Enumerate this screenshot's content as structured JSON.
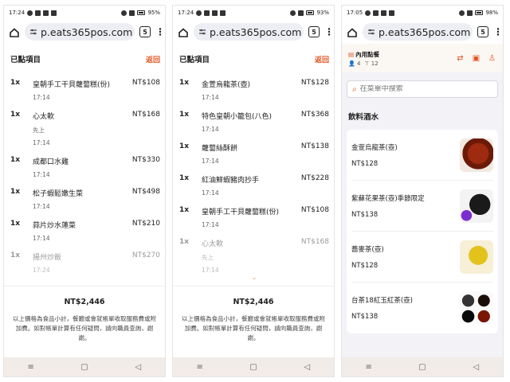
{
  "screens": [
    {
      "status": {
        "time": "17:24",
        "battery": "95%"
      },
      "url": "p.eats365pos.com",
      "tab_count": "5",
      "order_title": "已點項目",
      "back_label": "返回",
      "items": [
        {
          "qty": "1x",
          "name": "皇朝手工干貝蘿蔔糕(份)",
          "note": "",
          "time": "17:14",
          "price": "NT$108"
        },
        {
          "qty": "1x",
          "name": "心太軟",
          "note": "先上",
          "time": "17:14",
          "price": "NT$168"
        },
        {
          "qty": "1x",
          "name": "成都口水雞",
          "note": "",
          "time": "17:14",
          "price": "NT$330"
        },
        {
          "qty": "1x",
          "name": "松子蝦鬆嫩生菜",
          "note": "",
          "time": "17:14",
          "price": "NT$498"
        },
        {
          "qty": "1x",
          "name": "蒜片炒水蓮菜",
          "note": "",
          "time": "17:14",
          "price": "NT$210"
        },
        {
          "qty": "1x",
          "name": "揚州炒飯",
          "note": "",
          "time": "17:24",
          "price": "NT$270"
        }
      ],
      "total": "NT$2,446",
      "disclaimer": "以上價格為食品小計，餐廳或會就帳單收取服務費或附加費。如對帳單計算有任何疑問，請向職員查詢，謝謝。"
    },
    {
      "status": {
        "time": "17:24",
        "battery": "93%"
      },
      "url": "p.eats365pos.com",
      "tab_count": "5",
      "order_title": "已點項目",
      "back_label": "返回",
      "items": [
        {
          "qty": "1x",
          "name": "金萱烏龍茶(壺)",
          "note": "",
          "time": "17:14",
          "price": "NT$128"
        },
        {
          "qty": "1x",
          "name": "特色皇朝小籠包(八色)",
          "note": "",
          "time": "17:14",
          "price": "NT$368"
        },
        {
          "qty": "1x",
          "name": "蘿蔔絲酥餅",
          "note": "",
          "time": "17:14",
          "price": "NT$138"
        },
        {
          "qty": "1x",
          "name": "紅油鮮蝦豬肉抄手",
          "note": "",
          "time": "17:14",
          "price": "NT$228"
        },
        {
          "qty": "1x",
          "name": "皇朝手工干貝蘿蔔糕(份)",
          "note": "",
          "time": "17:14",
          "price": "NT$108"
        },
        {
          "qty": "1x",
          "name": "心太軟",
          "note": "先上",
          "time": "17:14",
          "price": "NT$168"
        }
      ],
      "total": "NT$2,446",
      "disclaimer": "以上價格為食品小計，餐廳或會就帳單收取服務費或附加費。如對帳單計算有任何疑問，請向職員查詢，謝謝。"
    },
    {
      "status": {
        "time": "17:05",
        "battery": "98%"
      },
      "url": "p.eats365pos.com",
      "tab_count": "5",
      "dine_title": "內用點餐",
      "guests": "4",
      "table": "12",
      "search_placeholder": "在菜單中搜索",
      "section_title": "飲料酒水",
      "menu_items": [
        {
          "name": "金萱烏龍茶(壺)",
          "price": "NT$128"
        },
        {
          "name": "紫蘇花果茶(壺)季節限定",
          "price": "NT$138"
        },
        {
          "name": "蕎麥茶(壺)",
          "price": "NT$128"
        },
        {
          "name": "台茶18紅玉紅茶(壺)",
          "price": "NT$138"
        }
      ]
    }
  ]
}
